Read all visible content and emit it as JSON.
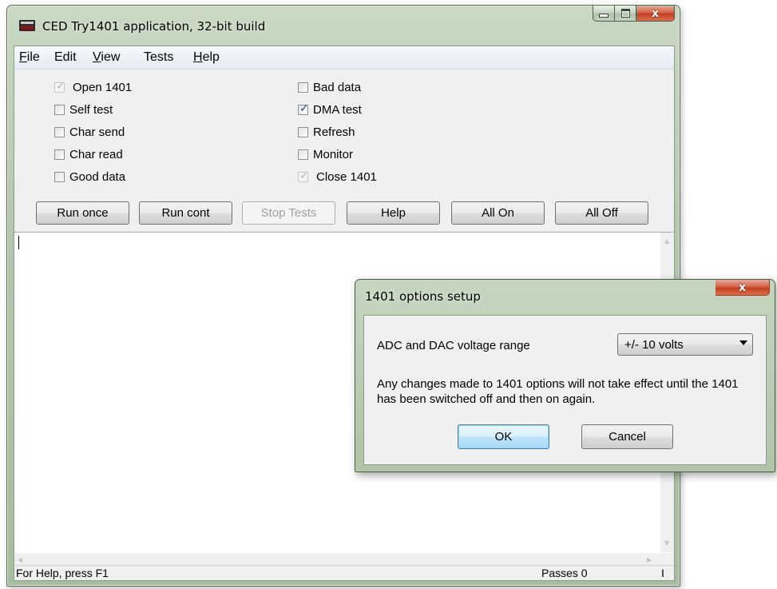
{
  "main_window": {
    "title": "CED Try1401 application, 32-bit build",
    "icon": "app-icon",
    "caption_buttons": {
      "minimize": "minimize-icon",
      "maximize": "maximize-icon",
      "close": "x"
    }
  },
  "menu": [
    {
      "label": "File",
      "underline": "F"
    },
    {
      "label": "Edit"
    },
    {
      "label": "View",
      "underline": "V"
    },
    {
      "label": "Tests"
    },
    {
      "label": "Help",
      "underline": "H"
    }
  ],
  "checkboxes": {
    "left": [
      {
        "label": "Open 1401",
        "checked": true,
        "disabled": true
      },
      {
        "label": "Self test",
        "checked": false
      },
      {
        "label": "Char send",
        "checked": false
      },
      {
        "label": "Char read",
        "checked": false
      },
      {
        "label": "Good data",
        "checked": false
      }
    ],
    "right": [
      {
        "label": "Bad data",
        "checked": false
      },
      {
        "label": "DMA test",
        "checked": true
      },
      {
        "label": "Refresh",
        "checked": false
      },
      {
        "label": "Monitor",
        "checked": false
      },
      {
        "label": "Close 1401",
        "checked": true,
        "disabled": true
      }
    ]
  },
  "buttons": [
    {
      "label": "Run once"
    },
    {
      "label": "Run cont"
    },
    {
      "label": "Stop Tests",
      "disabled": true
    },
    {
      "label": "Help"
    },
    {
      "label": "All On"
    },
    {
      "label": "All Off"
    }
  ],
  "output_text": "",
  "statusbar": {
    "help_text": "For Help, press F1",
    "passes": "Passes 0",
    "extra": "I"
  },
  "dialog": {
    "title": "1401 options setup",
    "close_label": "x",
    "range_label": "ADC and DAC voltage range",
    "range_value": "+/- 10 volts",
    "message": "Any changes made to 1401 options will not take effect until the 1401 has been switched off and then on again.",
    "ok_label": "OK",
    "cancel_label": "Cancel"
  }
}
